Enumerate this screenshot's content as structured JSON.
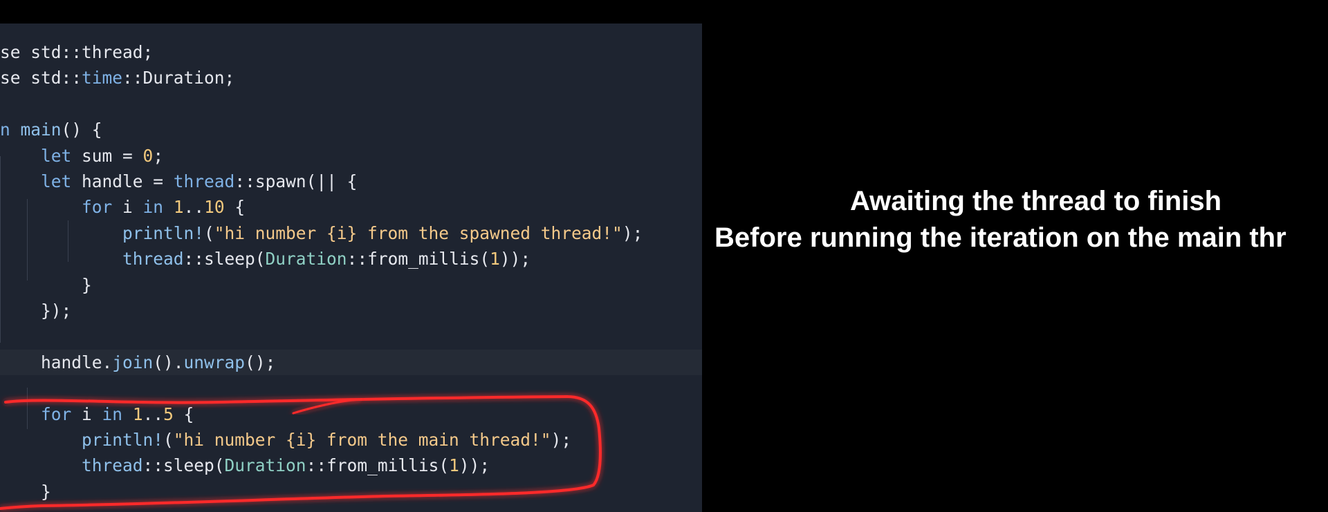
{
  "code_lines": [
    [
      {
        "t": "se std::",
        "c": "plain"
      },
      {
        "t": "thread",
        "c": "plain"
      },
      {
        "t": ";",
        "c": "plain"
      }
    ],
    [
      {
        "t": "se std::",
        "c": "plain"
      },
      {
        "t": "time",
        "c": "kw"
      },
      {
        "t": "::Duration;",
        "c": "plain"
      }
    ],
    [],
    [
      {
        "t": "n ",
        "c": "kw"
      },
      {
        "t": "main",
        "c": "macro"
      },
      {
        "t": "() {",
        "c": "plain"
      }
    ],
    [
      {
        "t": "    ",
        "c": "plain"
      },
      {
        "t": "let",
        "c": "kw"
      },
      {
        "t": " sum = ",
        "c": "plain"
      },
      {
        "t": "0",
        "c": "num"
      },
      {
        "t": ";",
        "c": "plain"
      }
    ],
    [
      {
        "t": "    ",
        "c": "plain"
      },
      {
        "t": "let",
        "c": "kw"
      },
      {
        "t": " handle = ",
        "c": "plain"
      },
      {
        "t": "thread",
        "c": "kw"
      },
      {
        "t": "::spawn(|| {",
        "c": "plain"
      }
    ],
    [
      {
        "t": "        ",
        "c": "plain"
      },
      {
        "t": "for",
        "c": "kw"
      },
      {
        "t": " i ",
        "c": "plain"
      },
      {
        "t": "in",
        "c": "kw"
      },
      {
        "t": " ",
        "c": "plain"
      },
      {
        "t": "1",
        "c": "num"
      },
      {
        "t": "..",
        "c": "plain"
      },
      {
        "t": "10",
        "c": "num"
      },
      {
        "t": " {",
        "c": "plain"
      }
    ],
    [
      {
        "t": "            ",
        "c": "plain"
      },
      {
        "t": "println!",
        "c": "macro"
      },
      {
        "t": "(",
        "c": "plain"
      },
      {
        "t": "\"hi number {i} from the spawned thread!\"",
        "c": "str"
      },
      {
        "t": ");",
        "c": "plain"
      }
    ],
    [
      {
        "t": "            ",
        "c": "plain"
      },
      {
        "t": "thread",
        "c": "macro"
      },
      {
        "t": "::sleep(",
        "c": "plain"
      },
      {
        "t": "Duration",
        "c": "type"
      },
      {
        "t": "::from_millis(",
        "c": "plain"
      },
      {
        "t": "1",
        "c": "num"
      },
      {
        "t": "));",
        "c": "plain"
      }
    ],
    [
      {
        "t": "        }",
        "c": "plain"
      }
    ],
    [
      {
        "t": "    });",
        "c": "plain"
      }
    ],
    [],
    [
      {
        "t": "    handle.",
        "c": "plain"
      },
      {
        "t": "join",
        "c": "macro"
      },
      {
        "t": "().",
        "c": "plain"
      },
      {
        "t": "unwrap",
        "c": "macro"
      },
      {
        "t": "();",
        "c": "plain"
      }
    ],
    [],
    [
      {
        "t": "    ",
        "c": "plain"
      },
      {
        "t": "for",
        "c": "kw"
      },
      {
        "t": " i ",
        "c": "plain"
      },
      {
        "t": "in",
        "c": "kw"
      },
      {
        "t": " ",
        "c": "plain"
      },
      {
        "t": "1",
        "c": "num"
      },
      {
        "t": "..",
        "c": "plain"
      },
      {
        "t": "5",
        "c": "num"
      },
      {
        "t": " {",
        "c": "plain"
      }
    ],
    [
      {
        "t": "        ",
        "c": "plain"
      },
      {
        "t": "println!",
        "c": "macro"
      },
      {
        "t": "(",
        "c": "plain"
      },
      {
        "t": "\"hi number {i} from the main thread!\"",
        "c": "str"
      },
      {
        "t": ");",
        "c": "plain"
      }
    ],
    [
      {
        "t": "        ",
        "c": "plain"
      },
      {
        "t": "thread",
        "c": "macro"
      },
      {
        "t": "::sleep(",
        "c": "plain"
      },
      {
        "t": "Duration",
        "c": "type"
      },
      {
        "t": "::from_millis(",
        "c": "plain"
      },
      {
        "t": "1",
        "c": "num"
      },
      {
        "t": "));",
        "c": "plain"
      }
    ],
    [
      {
        "t": "    }",
        "c": "plain"
      }
    ]
  ],
  "highlighted_line": 12,
  "caption": {
    "line1": "Awaiting the thread to finish",
    "line2": "Before running the iteration on the main thr"
  },
  "colors": {
    "editor_bg": "#1e2430",
    "keyword": "#7fb2e6",
    "string": "#f4c98a",
    "number": "#f2c97d",
    "type": "#8fd0c4",
    "annotation": "#ff2a2a"
  }
}
